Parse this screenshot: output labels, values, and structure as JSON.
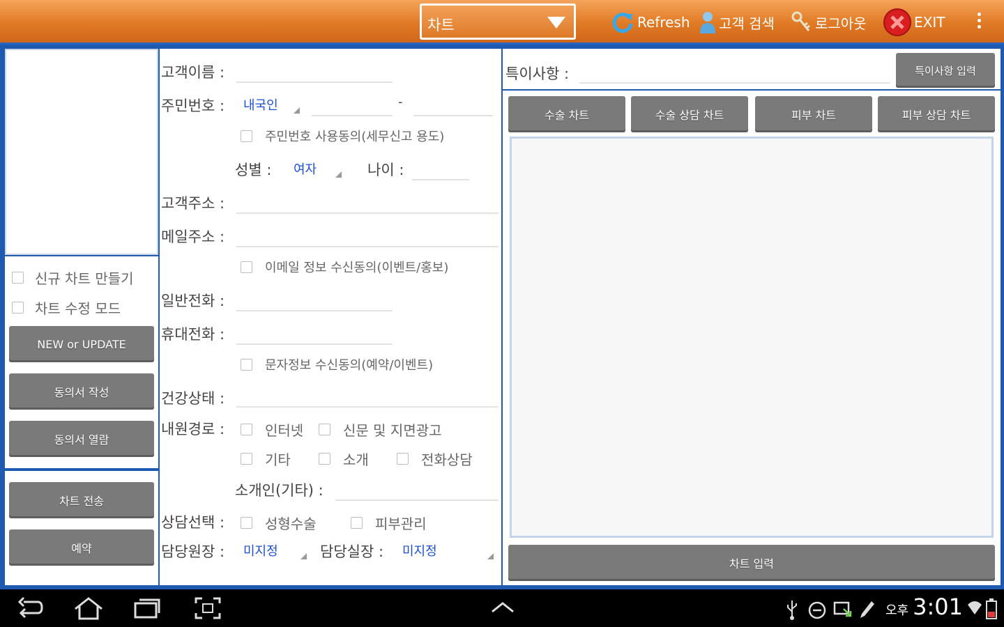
{
  "topbar": {
    "chart_select": "차트",
    "refresh": "Refresh",
    "customer_search": "고객 검색",
    "logout": "로그아웃",
    "exit": "EXIT"
  },
  "left": {
    "new_chart": "신규 차트 만들기",
    "edit_mode": "차트 수정 모드",
    "new_update": "NEW or UPDATE",
    "consent_write": "동의서 작성",
    "consent_view": "동의서 열람",
    "chart_send": "차트 전송",
    "reservation": "예약"
  },
  "form": {
    "name_label": "고객이름 :",
    "rrn_label": "주민번호 :",
    "nationality": "내국인",
    "rrn_sep": "-",
    "rrn_consent": "주민번호 사용동의(세무신고 용도)",
    "gender_label": "성별 :",
    "gender": "여자",
    "age_label": "나이 :",
    "address_label": "고객주소 :",
    "email_label": "메일주소 :",
    "email_consent": "이메일 정보 수신동의(이벤트/홍보)",
    "phone_label": "일반전화 :",
    "mobile_label": "휴대전화 :",
    "sms_consent": "문자정보 수신동의(예약/이벤트)",
    "health_label": "건강상태 :",
    "route_label": "내원경로 :",
    "route_internet": "인터넷",
    "route_newspaper": "신문 및 지면광고",
    "route_other": "기타",
    "route_referral": "소개",
    "route_phone": "전화상담",
    "referrer_label": "소개인(기타) :",
    "consult_label": "상담선택 :",
    "consult_plastic": "성형수술",
    "consult_skin": "피부관리",
    "director_label": "담당원장 :",
    "director": "미지정",
    "manager_label": "담당실장 :",
    "manager": "미지정"
  },
  "right": {
    "notes_label": "특이사항 :",
    "notes_button": "특이사항 입력",
    "tabs": [
      "수술 차트",
      "수술 상담 차트",
      "피부 차트",
      "피부 상담 차트"
    ],
    "chart_input": "차트 입력"
  },
  "statusbar": {
    "ampm": "오후",
    "time": "3:01"
  },
  "colors": {
    "topbar": "#e07a25",
    "frame": "#1e5bb0",
    "button": "#7a7a7a",
    "link_blue": "#1b4fd6"
  }
}
